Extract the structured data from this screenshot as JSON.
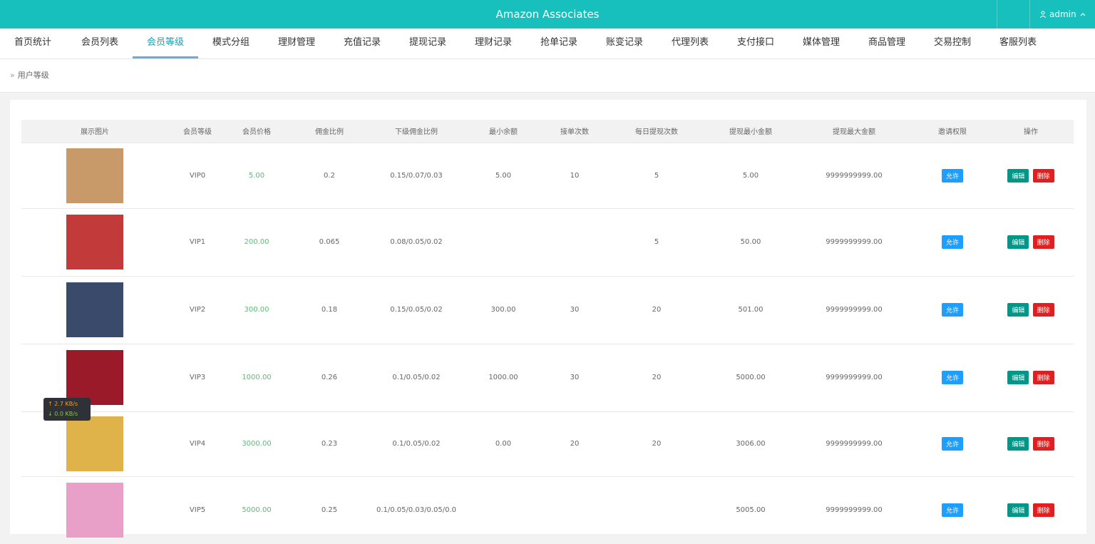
{
  "header": {
    "title": "Amazon Associates",
    "user": "admin"
  },
  "nav": {
    "items": [
      "首页统计",
      "会员列表",
      "会员等级",
      "模式分组",
      "理财管理",
      "充值记录",
      "提现记录",
      "理财记录",
      "抢单记录",
      "账变记录",
      "代理列表",
      "支付接口",
      "媒体管理",
      "商品管理",
      "交易控制",
      "客服列表"
    ],
    "active_index": 2
  },
  "breadcrumb": {
    "label": "用户等级"
  },
  "table": {
    "headers": [
      "展示图片",
      "会员等级",
      "会员价格",
      "佣金比例",
      "下级佣金比例",
      "最小余额",
      "接单次数",
      "每日提现次数",
      "提现最小金额",
      "提现最大金额",
      "邀请权限",
      "操作"
    ],
    "allow_label": "允许",
    "edit_label": "编辑",
    "delete_label": "删除",
    "rows": [
      {
        "level": "VIP0",
        "price": "5.00",
        "commission": "0.2",
        "sub_commission": "0.15/0.07/0.03",
        "min_balance": "5.00",
        "orders": "10",
        "daily_withdraw": "5",
        "withdraw_min": "5.00",
        "withdraw_max": "9999999999.00",
        "thumb_color": "#c89a6a"
      },
      {
        "level": "VIP1",
        "price": "200.00",
        "commission": "0.065",
        "sub_commission": "0.08/0.05/0.02",
        "min_balance": "",
        "orders": "",
        "daily_withdraw": "5",
        "withdraw_min": "50.00",
        "withdraw_max": "9999999999.00",
        "thumb_color": "#c23a3a"
      },
      {
        "level": "VIP2",
        "price": "300.00",
        "commission": "0.18",
        "sub_commission": "0.15/0.05/0.02",
        "min_balance": "300.00",
        "orders": "30",
        "daily_withdraw": "20",
        "withdraw_min": "501.00",
        "withdraw_max": "9999999999.00",
        "thumb_color": "#3a4a6a"
      },
      {
        "level": "VIP3",
        "price": "1000.00",
        "commission": "0.26",
        "sub_commission": "0.1/0.05/0.02",
        "min_balance": "1000.00",
        "orders": "30",
        "daily_withdraw": "20",
        "withdraw_min": "5000.00",
        "withdraw_max": "9999999999.00",
        "thumb_color": "#9a1a2a"
      },
      {
        "level": "VIP4",
        "price": "3000.00",
        "commission": "0.23",
        "sub_commission": "0.1/0.05/0.02",
        "min_balance": "0.00",
        "orders": "20",
        "daily_withdraw": "20",
        "withdraw_min": "3006.00",
        "withdraw_max": "9999999999.00",
        "thumb_color": "#e0b24a"
      },
      {
        "level": "VIP5",
        "price": "5000.00",
        "commission": "0.25",
        "sub_commission": "0.1/0.05/0.03/0.05/0.0",
        "min_balance": "",
        "orders": "",
        "daily_withdraw": "",
        "withdraw_min": "5005.00",
        "withdraw_max": "9999999999.00",
        "thumb_color": "#e8a0c8"
      }
    ]
  },
  "speed_widget": {
    "up": "↑ 2.7 KB/s",
    "down": "↓ 0.0 KB/s"
  }
}
